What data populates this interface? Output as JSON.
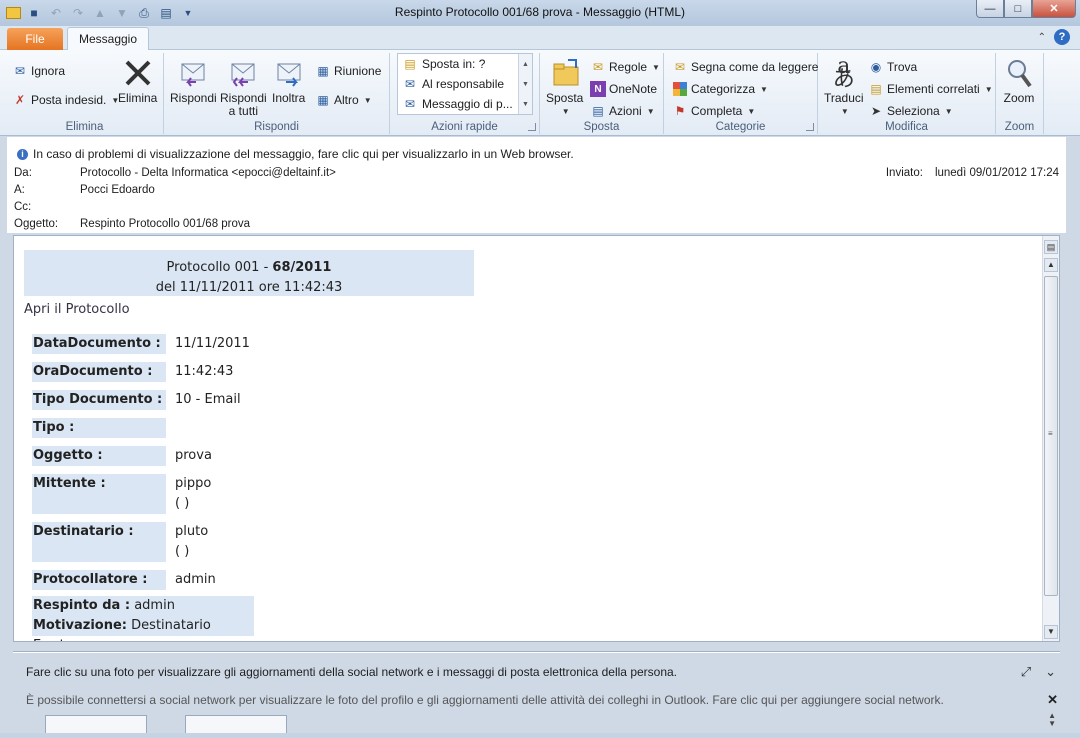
{
  "window": {
    "title": "Respinto Protocollo 001/68 prova  -  Messaggio (HTML)"
  },
  "tabs": {
    "file": "File",
    "messaggio": "Messaggio"
  },
  "ribbon": {
    "elimina_group": {
      "label": "Elimina",
      "ignora": "Ignora",
      "posta_indesiderata": "Posta indesid.",
      "elimina": "Elimina"
    },
    "rispondi_group": {
      "label": "Rispondi",
      "rispondi": "Rispondi",
      "rispondi_tutti_1": "Rispondi",
      "rispondi_tutti_2": "a tutti",
      "inoltra": "Inoltra",
      "riunione": "Riunione",
      "altro": "Altro"
    },
    "azioni_rapide_group": {
      "label": "Azioni rapide",
      "items": [
        "Sposta in: ?",
        "Al responsabile",
        "Messaggio di p..."
      ]
    },
    "sposta_group": {
      "label": "Sposta",
      "sposta": "Sposta",
      "regole": "Regole",
      "onenote": "OneNote",
      "azioni": "Azioni"
    },
    "categorie_group": {
      "label": "Categorie",
      "segna": "Segna come da leggere",
      "categorizza": "Categorizza",
      "completa": "Completa"
    },
    "modifica_group": {
      "label": "Modifica",
      "traduci": "Traduci",
      "trova": "Trova",
      "elementi_correlati": "Elementi correlati",
      "seleziona": "Seleziona"
    },
    "zoom_group": {
      "label": "Zoom",
      "zoom": "Zoom"
    }
  },
  "header": {
    "info": "In caso di problemi di visualizzazione del messaggio, fare clic qui per visualizzarlo in un Web browser.",
    "da_label": "Da:",
    "da": "Protocollo - Delta Informatica <epocci@deltainf.it>",
    "a_label": "A:",
    "a": "Pocci Edoardo",
    "cc_label": "Cc:",
    "cc": "",
    "oggetto_label": "Oggetto:",
    "oggetto": "Respinto Protocollo 001/68 prova",
    "inviato_label": "Inviato:",
    "inviato": "lunedì 09/01/2012 17:24"
  },
  "body": {
    "proto_line1_prefix": "Protocollo 001 - ",
    "proto_line1_bold": "68/2011",
    "proto_line2": "del 11/11/2011 ore 11:42:43",
    "apri": "Apri il Protocollo",
    "fields": [
      {
        "label": "DataDocumento :",
        "value": "11/11/2011",
        "value2": ""
      },
      {
        "label": "OraDocumento :",
        "value": "11:42:43",
        "value2": ""
      },
      {
        "label": "Tipo Documento :",
        "value": "10 - Email",
        "value2": ""
      },
      {
        "label": "Tipo :",
        "value": "",
        "value2": ""
      },
      {
        "label": "Oggetto :",
        "value": "prova",
        "value2": ""
      },
      {
        "label": "Mittente :",
        "value": "pippo",
        "value2": "( )"
      },
      {
        "label": "Destinatario :",
        "value": "pluto",
        "value2": "( )"
      },
      {
        "label": "Protocollatore :",
        "value": "admin",
        "value2": ""
      }
    ],
    "respinto_label": "Respinto da :",
    "respinto_value": "admin",
    "motivazione_label": "Motivazione:",
    "motivazione_value": "Destinatario Errato"
  },
  "social": {
    "line1": "Fare clic su una foto per visualizzare gli aggiornamenti della social network e i messaggi di posta elettronica della persona.",
    "line2": "È possibile connettersi a social network per visualizzare le foto del profilo e gli aggiornamenti delle attività dei colleghi in Outlook. Fare clic qui per aggiungere social network."
  }
}
